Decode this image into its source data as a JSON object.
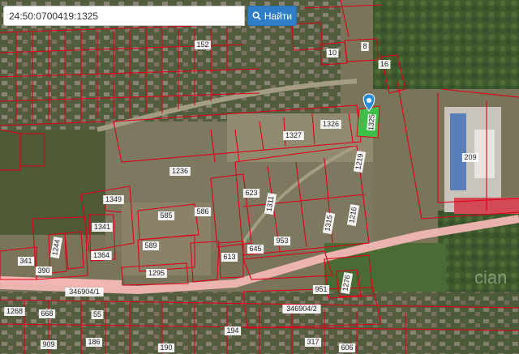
{
  "search": {
    "value": "24:50:0700419:1325",
    "button_label": "Найти",
    "icon": "search-icon"
  },
  "colors": {
    "boundary": "#e0001a",
    "selected_fill": "#3fbf4a",
    "marker": "#2a8bd8",
    "road": "#f2b7b4",
    "search_button": "#2f7fc8"
  },
  "map": {
    "selected_parcel": "1325",
    "plot_labels": [
      "10",
      "8",
      "16",
      "152",
      "209",
      "1236",
      "1326",
      "1327",
      "1219",
      "1349",
      "1341",
      "623",
      "1311",
      "1315",
      "1216",
      "586",
      "585",
      "589",
      "953",
      "645",
      "613",
      "1295",
      "1364",
      "1244",
      "341",
      "390",
      "346904/1",
      "346904/2",
      "951",
      "1268",
      "668",
      "55",
      "194",
      "317",
      "186",
      "190",
      "909",
      "606",
      "1276"
    ],
    "watermark": "cian"
  }
}
